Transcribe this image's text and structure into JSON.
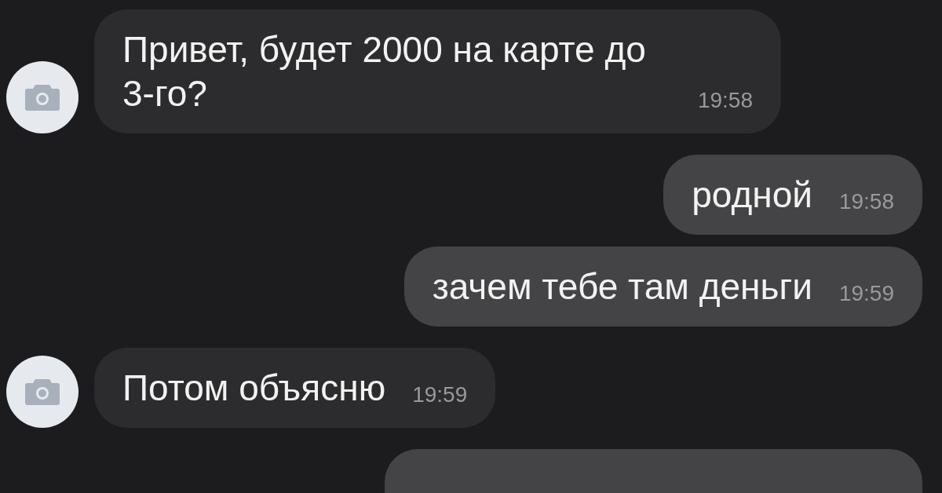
{
  "messages": [
    {
      "kind": "received",
      "text": "Привет, будет 2000 на карте до 3-го?",
      "time": "19:58"
    },
    {
      "kind": "sent",
      "text": "родной",
      "time": "19:58"
    },
    {
      "kind": "sent",
      "text": "зачем тебе там деньги",
      "time": "19:59"
    },
    {
      "kind": "received",
      "text": "Потом объясню",
      "time": "19:59"
    },
    {
      "kind": "sent"
    }
  ]
}
